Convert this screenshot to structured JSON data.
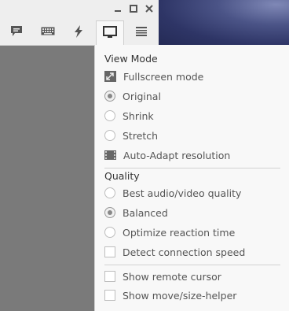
{
  "window": {
    "controls": [
      {
        "name": "minimize-icon",
        "glyph": "▂"
      },
      {
        "name": "maximize-icon",
        "glyph": "◻"
      },
      {
        "name": "close-icon",
        "glyph": "✕"
      }
    ]
  },
  "toolbar": {
    "buttons": [
      {
        "name": "chat-icon",
        "active": false
      },
      {
        "name": "keyboard-icon",
        "active": false
      },
      {
        "name": "lightning-icon",
        "active": false
      },
      {
        "name": "monitor-icon",
        "active": true
      },
      {
        "name": "menu-icon",
        "active": false
      }
    ]
  },
  "panel": {
    "view_mode": {
      "title": "View Mode",
      "fullscreen": "Fullscreen mode",
      "original": "Original",
      "shrink": "Shrink",
      "stretch": "Stretch",
      "auto_adapt": "Auto-Adapt resolution",
      "selected": "original"
    },
    "quality": {
      "title": "Quality",
      "best": "Best audio/video quality",
      "balanced": "Balanced",
      "optimize": "Optimize reaction time",
      "detect": "Detect connection speed",
      "selected": "balanced",
      "detect_checked": false
    },
    "extras": {
      "show_remote_cursor": "Show remote cursor",
      "show_move_helper": "Show move/size-helper",
      "remote_cursor_checked": false,
      "move_helper_checked": false
    }
  }
}
